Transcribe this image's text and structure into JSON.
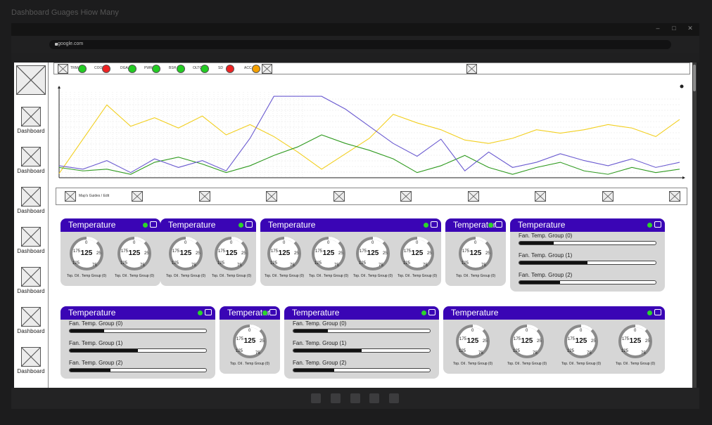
{
  "app_title": "Dashboard Guages Hiow Many",
  "window_controls": {
    "minimize": "–",
    "maximize": "□",
    "close": "✕"
  },
  "url": "google.com",
  "sidebar": {
    "items": [
      {
        "label": "Dashboard"
      },
      {
        "label": "Dashboard"
      },
      {
        "label": "Dashboard"
      },
      {
        "label": "Dashboard"
      },
      {
        "label": "Dashboard"
      },
      {
        "label": "Dashboard"
      },
      {
        "label": "Dashboard"
      }
    ]
  },
  "status_items": [
    {
      "label": "TRM",
      "color": "#22cc22"
    },
    {
      "label": "COOL",
      "color": "#ee2222"
    },
    {
      "label": "DGA",
      "color": "#22cc22"
    },
    {
      "label": "PWR",
      "color": "#22cc22"
    },
    {
      "label": "BSH",
      "color": "#22cc22"
    },
    {
      "label": "OLTC",
      "color": "#22cc22"
    },
    {
      "label": "SD",
      "color": "#ee2222"
    },
    {
      "label": "ACC",
      "color": "#f4a000"
    }
  ],
  "map_bar": {
    "label": "Map's Guides / Edit"
  },
  "chart_data": {
    "type": "line",
    "x": [
      0,
      1,
      2,
      3,
      4,
      5,
      6,
      7,
      8,
      9,
      10,
      11,
      12,
      13,
      14,
      15,
      16,
      17,
      18,
      19,
      20,
      21,
      22,
      23,
      24,
      25,
      26
    ],
    "series": [
      {
        "color": "#f2cf1f",
        "values": [
          5,
          45,
          85,
          60,
          70,
          58,
          72,
          50,
          62,
          48,
          30,
          10,
          28,
          46,
          74,
          64,
          56,
          44,
          40,
          46,
          56,
          52,
          56,
          62,
          58,
          48,
          68
        ]
      },
      {
        "color": "#2f9a1f",
        "values": [
          12,
          8,
          10,
          4,
          18,
          24,
          16,
          6,
          14,
          26,
          36,
          50,
          40,
          32,
          22,
          6,
          14,
          26,
          12,
          4,
          12,
          18,
          8,
          4,
          12,
          6,
          10
        ]
      },
      {
        "color": "#6a5ad0",
        "values": [
          14,
          10,
          20,
          6,
          22,
          12,
          20,
          8,
          46,
          95,
          95,
          95,
          80,
          60,
          40,
          25,
          45,
          8,
          30,
          12,
          18,
          28,
          20,
          14,
          22,
          12,
          18
        ]
      }
    ],
    "ylim": [
      0,
      100
    ],
    "grid": true,
    "legend": "none"
  },
  "gauge_common": {
    "value": "125",
    "t0": "0",
    "t25": "25",
    "t75": "75",
    "t125": "125",
    "t175": "175",
    "caption": "Top. Oil . Temp Group (0)"
  },
  "panels": [
    {
      "title": "Temperature",
      "gauges": 2
    },
    {
      "title": "Temperature",
      "gauges": 2
    },
    {
      "title": "Temperature",
      "gauges": 4
    },
    {
      "title": "Temperature",
      "gauges": 1
    },
    {
      "title": "Temperature",
      "bars": [
        {
          "label": "Fan. Temp. Group (0)",
          "fill": 0.25
        },
        {
          "label": "Fan. Temp. Group (1)",
          "fill": 0.5
        },
        {
          "label": "Fan. Temp. Group (2)",
          "fill": 0.3
        }
      ]
    },
    {
      "title": "Temperature",
      "bars": [
        {
          "label": "Fan. Temp. Group (0)",
          "fill": 0.25
        },
        {
          "label": "Fan. Temp. Group (1)",
          "fill": 0.5
        },
        {
          "label": "Fan. Temp. Group (2)",
          "fill": 0.3
        }
      ]
    },
    {
      "title": "Temperature",
      "gauges": 1
    },
    {
      "title": "Temperature",
      "bars": [
        {
          "label": "Fan. Temp. Group (0)",
          "fill": 0.25
        },
        {
          "label": "Fan. Temp. Group (1)",
          "fill": 0.5
        },
        {
          "label": "Fan. Temp. Group (2)",
          "fill": 0.3
        }
      ]
    },
    {
      "title": "Temperature",
      "gauges": 4
    }
  ],
  "colors": {
    "header": "#3a05b5",
    "status_ok": "#2bd52b",
    "panel_bg": "#d6d6d6"
  }
}
